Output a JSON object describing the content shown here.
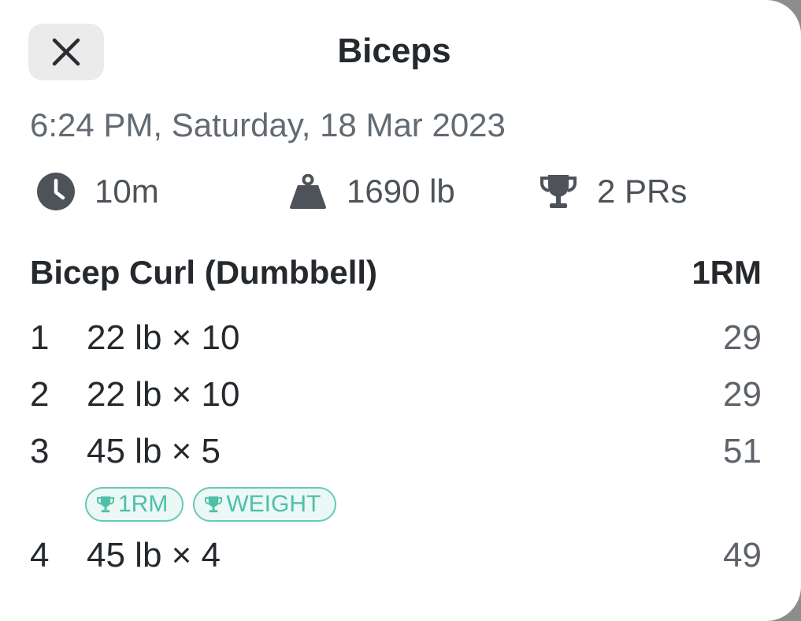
{
  "header": {
    "title": "Biceps",
    "close_icon": "close-icon"
  },
  "workout": {
    "date": "6:24 PM, Saturday, 18 Mar 2023",
    "duration": "10m",
    "volume": "1690 lb",
    "prs": "2 PRs"
  },
  "exercise": {
    "name": "Bicep Curl (Dumbbell)",
    "column_label": "1RM",
    "sets": [
      {
        "num": "1",
        "desc": "22 lb × 10",
        "one_rm": "29"
      },
      {
        "num": "2",
        "desc": "22 lb × 10",
        "one_rm": "29"
      },
      {
        "num": "3",
        "desc": "45 lb × 5",
        "one_rm": "51"
      },
      {
        "num": "4",
        "desc": "45 lb × 4",
        "one_rm": "49"
      }
    ],
    "pr_badges": [
      "1RM",
      "WEIGHT"
    ]
  },
  "colors": {
    "accent": "#4fbfa8",
    "badge_bg": "#ebf8f5",
    "text_primary": "#25292d",
    "text_secondary": "#636a71"
  }
}
